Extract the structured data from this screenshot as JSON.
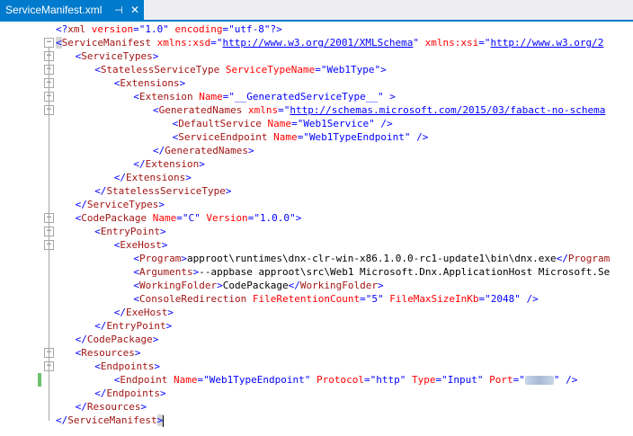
{
  "tab": {
    "title": "ServiceManifest.xml",
    "pin": "⊣",
    "close": "✕"
  },
  "colors": {
    "accent": "#007acc",
    "element": "#a31515",
    "attribute": "#ff0000",
    "value": "#0000ff",
    "bracket": "#0000ff",
    "change_bar": "#6dc06d"
  },
  "lines": [
    {
      "indent": 0,
      "toggle": false,
      "tokens": [
        [
          "b",
          "<?"
        ],
        [
          "el",
          "xml"
        ],
        [
          "at",
          " version"
        ],
        [
          "b",
          "="
        ],
        [
          "b",
          "\""
        ],
        [
          "vl",
          "1.0"
        ],
        [
          "b",
          "\""
        ],
        [
          "at",
          " encoding"
        ],
        [
          "b",
          "="
        ],
        [
          "b",
          "\""
        ],
        [
          "vl",
          "utf-8"
        ],
        [
          "b",
          "\""
        ],
        [
          "b",
          "?>"
        ]
      ]
    },
    {
      "indent": 0,
      "toggle": true,
      "tokens": [
        [
          "bs",
          "<"
        ],
        [
          "el",
          "ServiceManifest"
        ],
        [
          "at",
          " xmlns:xsd"
        ],
        [
          "b",
          "="
        ],
        [
          "b",
          "\""
        ],
        [
          "url",
          "http://www.w3.org/2001/XMLSchema"
        ],
        [
          "b",
          "\""
        ],
        [
          "at",
          " xmlns:xsi"
        ],
        [
          "b",
          "="
        ],
        [
          "b",
          "\""
        ],
        [
          "url",
          "http://www.w3.org/2"
        ]
      ]
    },
    {
      "indent": 1,
      "toggle": true,
      "tokens": [
        [
          "b",
          "<"
        ],
        [
          "el",
          "ServiceTypes"
        ],
        [
          "b",
          ">"
        ]
      ]
    },
    {
      "indent": 2,
      "toggle": true,
      "tokens": [
        [
          "b",
          "<"
        ],
        [
          "el",
          "StatelessServiceType"
        ],
        [
          "at",
          " ServiceTypeName"
        ],
        [
          "b",
          "="
        ],
        [
          "b",
          "\""
        ],
        [
          "vl",
          "Web1Type"
        ],
        [
          "b",
          "\""
        ],
        [
          "b",
          ">"
        ]
      ]
    },
    {
      "indent": 3,
      "toggle": true,
      "tokens": [
        [
          "b",
          "<"
        ],
        [
          "el",
          "Extensions"
        ],
        [
          "b",
          ">"
        ]
      ]
    },
    {
      "indent": 4,
      "toggle": true,
      "tokens": [
        [
          "b",
          "<"
        ],
        [
          "el",
          "Extension"
        ],
        [
          "at",
          " Name"
        ],
        [
          "b",
          "="
        ],
        [
          "b",
          "\""
        ],
        [
          "vl",
          "__GeneratedServiceType__"
        ],
        [
          "b",
          "\""
        ],
        [
          "b",
          " >"
        ]
      ]
    },
    {
      "indent": 5,
      "toggle": true,
      "tokens": [
        [
          "b",
          "<"
        ],
        [
          "el",
          "GeneratedNames"
        ],
        [
          "at",
          " xmlns"
        ],
        [
          "b",
          "="
        ],
        [
          "b",
          "\""
        ],
        [
          "url",
          "http://schemas.microsoft.com/2015/03/fabact-no-schema"
        ]
      ]
    },
    {
      "indent": 6,
      "toggle": false,
      "tokens": [
        [
          "b",
          "<"
        ],
        [
          "el",
          "DefaultService"
        ],
        [
          "at",
          " Name"
        ],
        [
          "b",
          "="
        ],
        [
          "b",
          "\""
        ],
        [
          "vl",
          "Web1Service"
        ],
        [
          "b",
          "\""
        ],
        [
          "b",
          " />"
        ]
      ]
    },
    {
      "indent": 6,
      "toggle": false,
      "tokens": [
        [
          "b",
          "<"
        ],
        [
          "el",
          "ServiceEndpoint"
        ],
        [
          "at",
          " Name"
        ],
        [
          "b",
          "="
        ],
        [
          "b",
          "\""
        ],
        [
          "vl",
          "Web1TypeEndpoint"
        ],
        [
          "b",
          "\""
        ],
        [
          "b",
          " />"
        ]
      ]
    },
    {
      "indent": 5,
      "toggle": false,
      "tokens": [
        [
          "b",
          "</"
        ],
        [
          "el",
          "GeneratedNames"
        ],
        [
          "b",
          ">"
        ]
      ]
    },
    {
      "indent": 4,
      "toggle": false,
      "tokens": [
        [
          "b",
          "</"
        ],
        [
          "el",
          "Extension"
        ],
        [
          "b",
          ">"
        ]
      ]
    },
    {
      "indent": 3,
      "toggle": false,
      "tokens": [
        [
          "b",
          "</"
        ],
        [
          "el",
          "Extensions"
        ],
        [
          "b",
          ">"
        ]
      ]
    },
    {
      "indent": 2,
      "toggle": false,
      "tokens": [
        [
          "b",
          "</"
        ],
        [
          "el",
          "StatelessServiceType"
        ],
        [
          "b",
          ">"
        ]
      ]
    },
    {
      "indent": 1,
      "toggle": false,
      "tokens": [
        [
          "b",
          "</"
        ],
        [
          "el",
          "ServiceTypes"
        ],
        [
          "b",
          ">"
        ]
      ]
    },
    {
      "indent": 1,
      "toggle": true,
      "tokens": [
        [
          "b",
          "<"
        ],
        [
          "el",
          "CodePackage"
        ],
        [
          "at",
          " Name"
        ],
        [
          "b",
          "="
        ],
        [
          "b",
          "\""
        ],
        [
          "vl",
          "C"
        ],
        [
          "b",
          "\""
        ],
        [
          "at",
          " Version"
        ],
        [
          "b",
          "="
        ],
        [
          "b",
          "\""
        ],
        [
          "vl",
          "1.0.0"
        ],
        [
          "b",
          "\""
        ],
        [
          "b",
          ">"
        ]
      ]
    },
    {
      "indent": 2,
      "toggle": true,
      "tokens": [
        [
          "b",
          "<"
        ],
        [
          "el",
          "EntryPoint"
        ],
        [
          "b",
          ">"
        ]
      ]
    },
    {
      "indent": 3,
      "toggle": true,
      "tokens": [
        [
          "b",
          "<"
        ],
        [
          "el",
          "ExeHost"
        ],
        [
          "b",
          ">"
        ]
      ]
    },
    {
      "indent": 4,
      "toggle": false,
      "tokens": [
        [
          "b",
          "<"
        ],
        [
          "el",
          "Program"
        ],
        [
          "b",
          ">"
        ],
        [
          "tx",
          "approot\\runtimes\\dnx-clr-win-x86.1.0.0-rc1-update1\\bin\\dnx.exe"
        ],
        [
          "b",
          "</"
        ],
        [
          "el",
          "Program"
        ]
      ]
    },
    {
      "indent": 4,
      "toggle": false,
      "tokens": [
        [
          "b",
          "<"
        ],
        [
          "el",
          "Arguments"
        ],
        [
          "b",
          ">"
        ],
        [
          "tx",
          "--appbase approot\\src\\Web1 Microsoft.Dnx.ApplicationHost Microsoft.Se"
        ]
      ]
    },
    {
      "indent": 4,
      "toggle": false,
      "tokens": [
        [
          "b",
          "<"
        ],
        [
          "el",
          "WorkingFolder"
        ],
        [
          "b",
          ">"
        ],
        [
          "tx",
          "CodePackage"
        ],
        [
          "b",
          "</"
        ],
        [
          "el",
          "WorkingFolder"
        ],
        [
          "b",
          ">"
        ]
      ]
    },
    {
      "indent": 4,
      "toggle": false,
      "tokens": [
        [
          "b",
          "<"
        ],
        [
          "el",
          "ConsoleRedirection"
        ],
        [
          "at",
          " FileRetentionCount"
        ],
        [
          "b",
          "="
        ],
        [
          "b",
          "\""
        ],
        [
          "vl",
          "5"
        ],
        [
          "b",
          "\""
        ],
        [
          "at",
          " FileMaxSizeInKb"
        ],
        [
          "b",
          "="
        ],
        [
          "b",
          "\""
        ],
        [
          "vl",
          "2048"
        ],
        [
          "b",
          "\""
        ],
        [
          "b",
          " />"
        ]
      ]
    },
    {
      "indent": 3,
      "toggle": false,
      "tokens": [
        [
          "b",
          "</"
        ],
        [
          "el",
          "ExeHost"
        ],
        [
          "b",
          ">"
        ]
      ]
    },
    {
      "indent": 2,
      "toggle": false,
      "tokens": [
        [
          "b",
          "</"
        ],
        [
          "el",
          "EntryPoint"
        ],
        [
          "b",
          ">"
        ]
      ]
    },
    {
      "indent": 1,
      "toggle": false,
      "tokens": [
        [
          "b",
          "</"
        ],
        [
          "el",
          "CodePackage"
        ],
        [
          "b",
          ">"
        ]
      ]
    },
    {
      "indent": 1,
      "toggle": true,
      "tokens": [
        [
          "b",
          "<"
        ],
        [
          "el",
          "Resources"
        ],
        [
          "b",
          ">"
        ]
      ]
    },
    {
      "indent": 2,
      "toggle": true,
      "tokens": [
        [
          "b",
          "<"
        ],
        [
          "el",
          "Endpoints"
        ],
        [
          "b",
          ">"
        ]
      ]
    },
    {
      "indent": 3,
      "toggle": false,
      "changed": true,
      "tokens": [
        [
          "b",
          "<"
        ],
        [
          "el",
          "Endpoint"
        ],
        [
          "at",
          " Name"
        ],
        [
          "b",
          "="
        ],
        [
          "b",
          "\""
        ],
        [
          "vl",
          "Web1TypeEndpoint"
        ],
        [
          "b",
          "\""
        ],
        [
          "at",
          " Protocol"
        ],
        [
          "b",
          "="
        ],
        [
          "b",
          "\""
        ],
        [
          "vl",
          "http"
        ],
        [
          "b",
          "\""
        ],
        [
          "at",
          " Type"
        ],
        [
          "b",
          "="
        ],
        [
          "b",
          "\""
        ],
        [
          "vl",
          "Input"
        ],
        [
          "b",
          "\""
        ],
        [
          "at",
          " Port"
        ],
        [
          "b",
          "="
        ],
        [
          "b",
          "\""
        ],
        [
          "blur",
          ""
        ],
        [
          "b",
          "\""
        ],
        [
          "b",
          " />"
        ]
      ]
    },
    {
      "indent": 2,
      "toggle": false,
      "tokens": [
        [
          "b",
          "</"
        ],
        [
          "el",
          "Endpoints"
        ],
        [
          "b",
          ">"
        ]
      ]
    },
    {
      "indent": 1,
      "toggle": false,
      "tokens": [
        [
          "b",
          "</"
        ],
        [
          "el",
          "Resources"
        ],
        [
          "b",
          ">"
        ]
      ]
    },
    {
      "indent": 0,
      "toggle": false,
      "tokens": [
        [
          "b",
          "</"
        ],
        [
          "el",
          "ServiceManifest"
        ],
        [
          "bs",
          ">"
        ],
        [
          "caret",
          ""
        ]
      ]
    }
  ]
}
